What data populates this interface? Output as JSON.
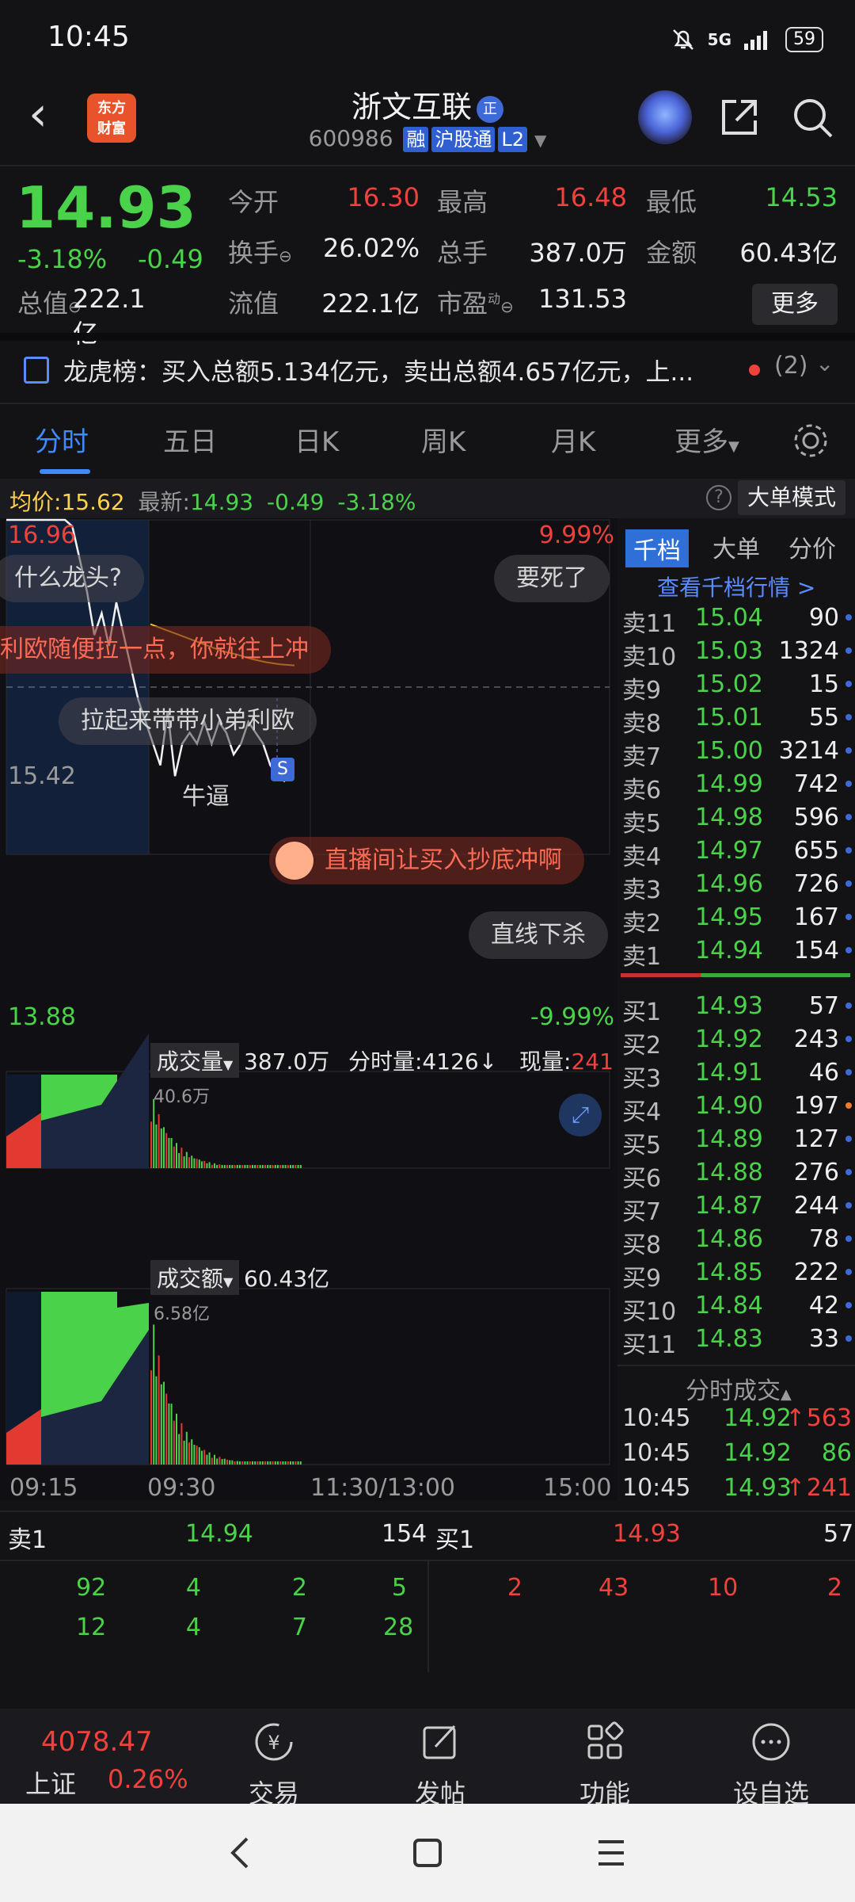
{
  "status_bar": {
    "time": "10:45",
    "network": "5G",
    "battery": "59"
  },
  "header": {
    "logo_text": "东方\n财富",
    "stock_name": "浙文互联",
    "badge": "正",
    "code": "600986",
    "tags": [
      "融",
      "沪股通",
      "L2"
    ]
  },
  "quote": {
    "price": "14.93",
    "change_pct": "-3.18%",
    "change": "-0.49",
    "fields": [
      {
        "label": "今开",
        "value": "16.30",
        "color": "red"
      },
      {
        "label": "最高",
        "value": "16.48",
        "color": "red"
      },
      {
        "label": "最低",
        "value": "14.53",
        "color": "green"
      },
      {
        "label": "换手",
        "value": "26.02%",
        "color": "white"
      },
      {
        "label": "总手",
        "value": "387.0万",
        "color": "white"
      },
      {
        "label": "金额",
        "value": "60.43亿",
        "color": "white"
      },
      {
        "label": "总值",
        "value": "222.1亿",
        "color": "white"
      },
      {
        "label": "流值",
        "value": "222.1亿",
        "color": "white"
      },
      {
        "label": "市盈",
        "value": "131.53",
        "color": "white"
      }
    ],
    "pe_sup": "动",
    "more_label": "更多"
  },
  "notice": {
    "text": "龙虎榜：买入总额5.134亿元，卖出总额4.657亿元，上...",
    "count": "(2)"
  },
  "tabs": [
    "分时",
    "五日",
    "日K",
    "周K",
    "月K",
    "更多"
  ],
  "avg_line": {
    "avg_label": "均价:",
    "avg_value": "15.62",
    "latest_label": "最新:",
    "latest_value": "14.93",
    "change": "-0.49",
    "change_pct": "-3.18%",
    "mode_button": "大单模式"
  },
  "chart_data": {
    "type": "line",
    "y_top": "16.96",
    "y_mid": "15.42",
    "y_bottom": "13.88",
    "pct_top": "9.99%",
    "pct_bottom": "-9.99%",
    "price_line": [
      16.96,
      16.96,
      16.96,
      16.96,
      16.96,
      16.96,
      16.96,
      16.96,
      16.96,
      16.9,
      16.6,
      16.3,
      15.9,
      16.1,
      15.8,
      16.2,
      15.9,
      15.6,
      15.3,
      15.1,
      14.9,
      14.7,
      15.2,
      14.6,
      14.9,
      15.0,
      14.9,
      15.1,
      14.9,
      15.1,
      15.0,
      14.8,
      14.9,
      15.1,
      15.0,
      14.9,
      14.7,
      14.6,
      14.55
    ],
    "avg_line": [
      16.0,
      15.95,
      15.9,
      15.85,
      15.8,
      15.75,
      15.72,
      15.68,
      15.65,
      15.63,
      15.62
    ],
    "x_ticks": [
      "09:15",
      "09:30",
      "11:30/13:00",
      "15:00"
    ],
    "volume": {
      "label": "成交量",
      "total": "387.0万",
      "tick_label": "分时量:4126",
      "current_label": "现量:",
      "current_value": "241",
      "max_label": "40.6万"
    },
    "amount": {
      "label": "成交额",
      "total": "60.43亿",
      "max_label": "6.58亿"
    }
  },
  "bullets": [
    {
      "text": "什么龙头?",
      "hot": false
    },
    {
      "text": "要死了",
      "hot": false
    },
    {
      "text": "利欧随便拉一点，你就往上冲",
      "hot": true
    },
    {
      "text": "拉起来带带小弟利欧",
      "hot": false
    },
    {
      "text": "直播间让买入抄底冲啊",
      "hot": true
    },
    {
      "text": "直线下杀",
      "hot": false
    },
    {
      "text": "牛逼",
      "hot": false
    }
  ],
  "orderbook": {
    "tabs": [
      "千档",
      "大单",
      "分价"
    ],
    "link": "查看千档行情 >",
    "asks": [
      {
        "label": "卖11",
        "price": "15.04",
        "vol": "90"
      },
      {
        "label": "卖10",
        "price": "15.03",
        "vol": "1324"
      },
      {
        "label": "卖9",
        "price": "15.02",
        "vol": "15"
      },
      {
        "label": "卖8",
        "price": "15.01",
        "vol": "55"
      },
      {
        "label": "卖7",
        "price": "15.00",
        "vol": "3214"
      },
      {
        "label": "卖6",
        "price": "14.99",
        "vol": "742"
      },
      {
        "label": "卖5",
        "price": "14.98",
        "vol": "596"
      },
      {
        "label": "卖4",
        "price": "14.97",
        "vol": "655"
      },
      {
        "label": "卖3",
        "price": "14.96",
        "vol": "726"
      },
      {
        "label": "卖2",
        "price": "14.95",
        "vol": "167"
      },
      {
        "label": "卖1",
        "price": "14.94",
        "vol": "154"
      }
    ],
    "bids": [
      {
        "label": "买1",
        "price": "14.93",
        "vol": "57"
      },
      {
        "label": "买2",
        "price": "14.92",
        "vol": "243"
      },
      {
        "label": "买3",
        "price": "14.91",
        "vol": "46"
      },
      {
        "label": "买4",
        "price": "14.90",
        "vol": "197"
      },
      {
        "label": "买5",
        "price": "14.89",
        "vol": "127"
      },
      {
        "label": "买6",
        "price": "14.88",
        "vol": "276"
      },
      {
        "label": "买7",
        "price": "14.87",
        "vol": "244"
      },
      {
        "label": "买8",
        "price": "14.86",
        "vol": "78"
      },
      {
        "label": "买9",
        "price": "14.85",
        "vol": "222"
      },
      {
        "label": "买10",
        "price": "14.84",
        "vol": "42"
      },
      {
        "label": "买11",
        "price": "14.83",
        "vol": "33"
      }
    ],
    "ticks_title": "分时成交",
    "ticks": [
      {
        "time": "10:45",
        "price": "14.92",
        "arrow": "↑",
        "vol": "563"
      },
      {
        "time": "10:45",
        "price": "14.92",
        "arrow": "",
        "vol": "86"
      },
      {
        "time": "10:45",
        "price": "14.93",
        "arrow": "↑",
        "vol": "241"
      }
    ]
  },
  "bottom_queue": {
    "sell_label": "卖1",
    "sell_price": "14.94",
    "sell_vol": "154",
    "buy_label": "买1",
    "buy_price": "14.93",
    "buy_vol": "57",
    "sell_rows": [
      [
        "92",
        "4",
        "2",
        "5"
      ],
      [
        "12",
        "4",
        "7",
        "28"
      ]
    ],
    "buy_rows": [
      [
        "2",
        "43",
        "10",
        "2"
      ]
    ]
  },
  "toolbar": {
    "index_value": "4078.47",
    "index_name": "上证",
    "index_pct": "0.26%",
    "items": [
      "交易",
      "发帖",
      "功能",
      "设自选"
    ]
  }
}
